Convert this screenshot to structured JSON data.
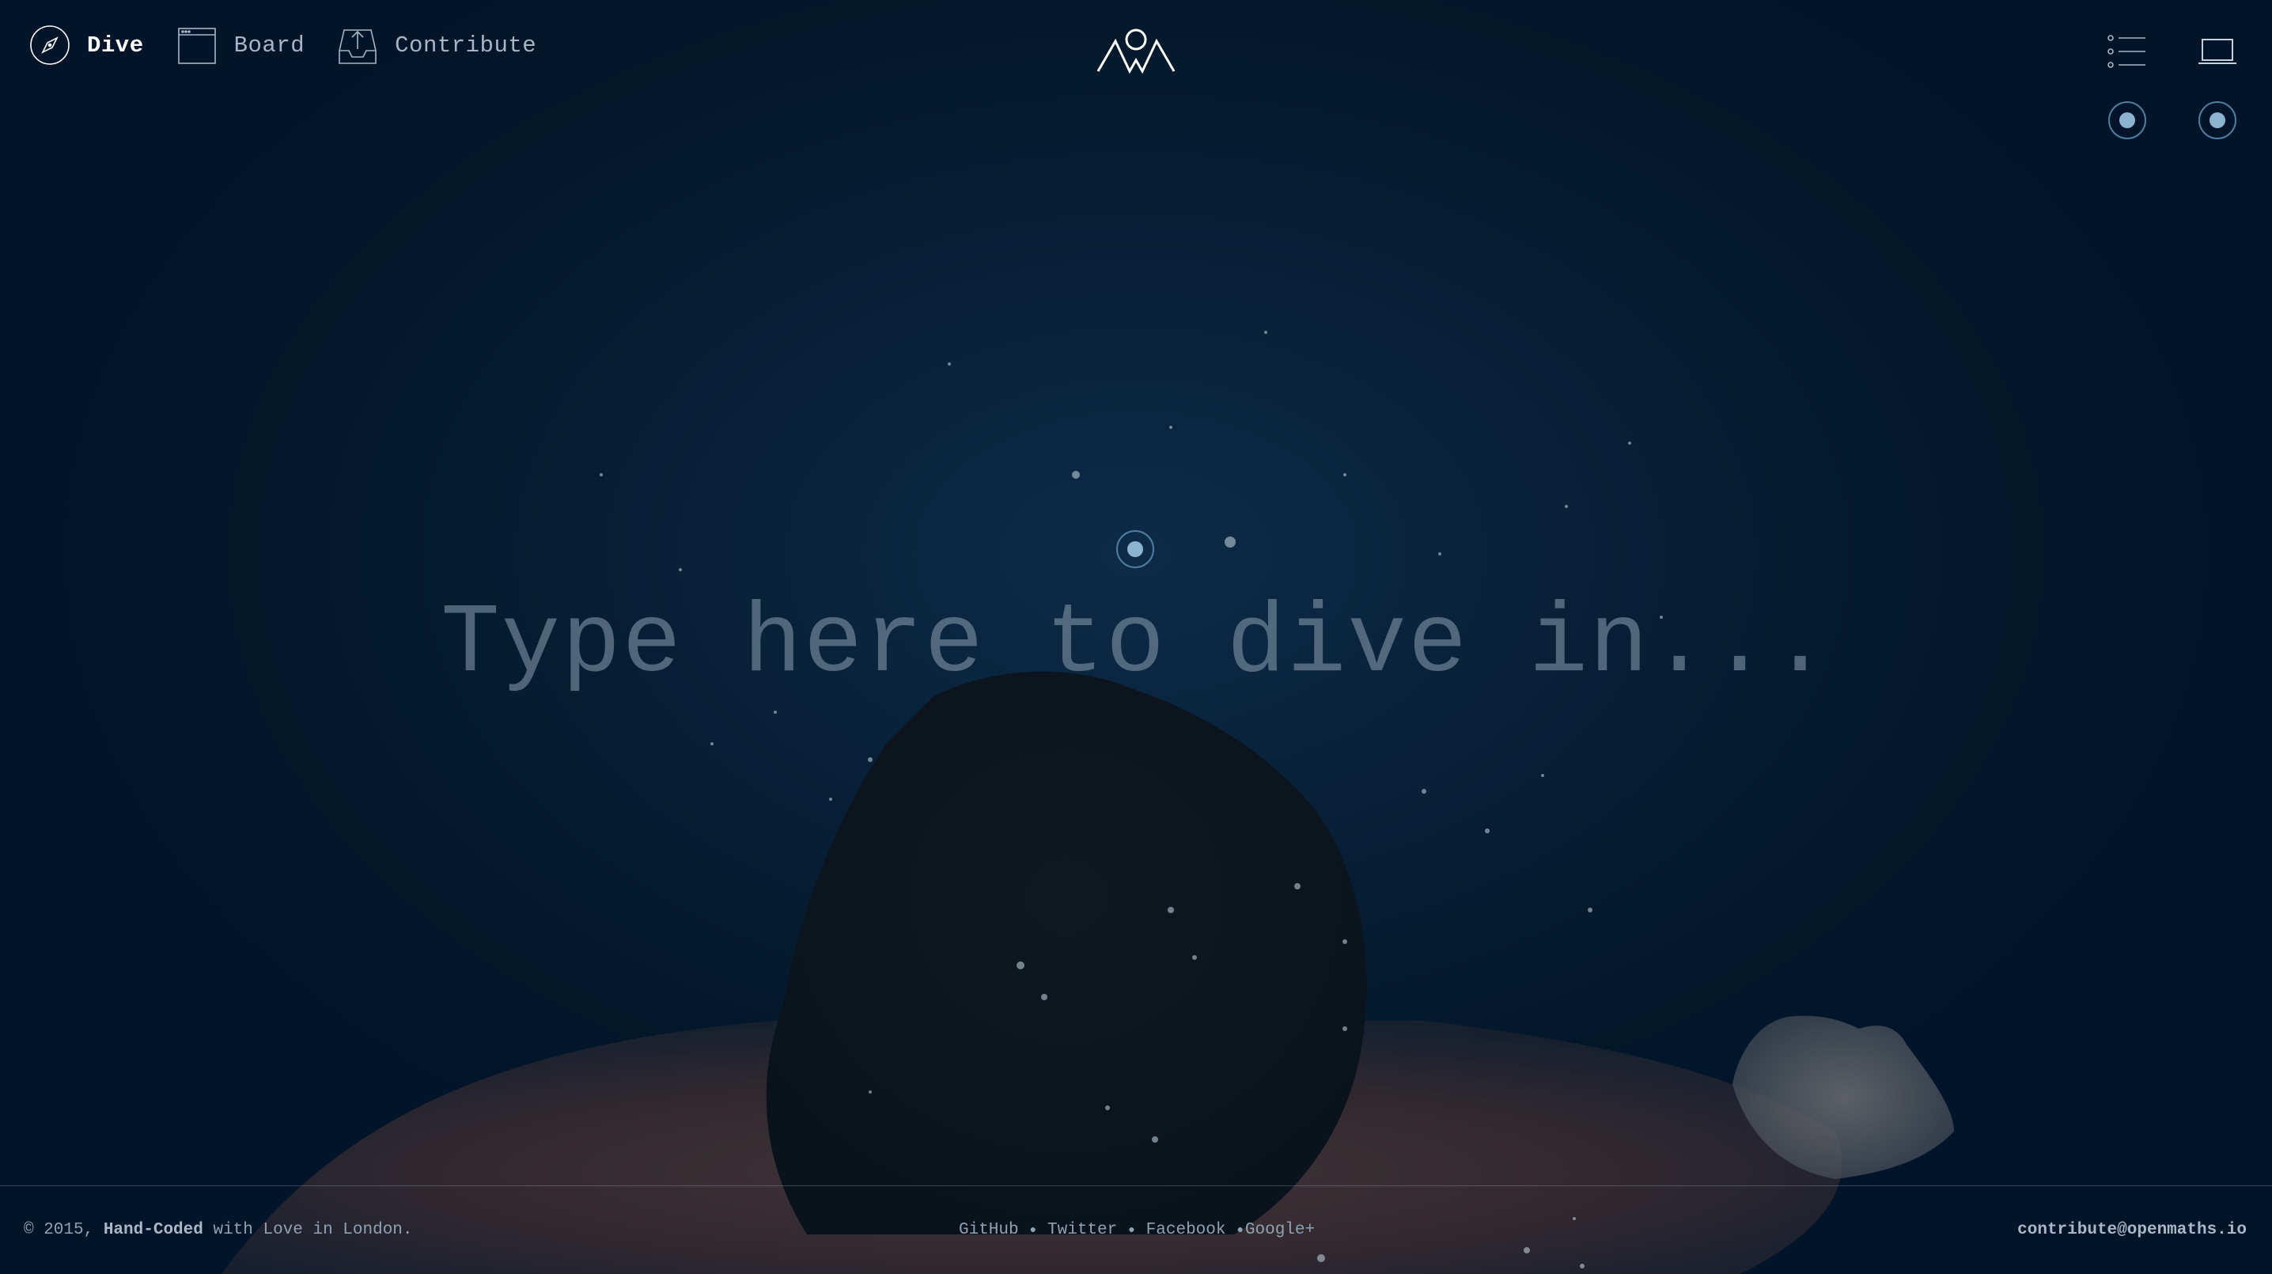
{
  "nav": {
    "items": [
      {
        "label": "Dive",
        "icon": "compass-icon",
        "active": true
      },
      {
        "label": "Board",
        "icon": "browser-window-icon",
        "active": false
      },
      {
        "label": "Contribute",
        "icon": "tray-upload-icon",
        "active": false
      }
    ]
  },
  "logo": {
    "name": "mountain-circle-logo"
  },
  "top_right": {
    "icons": [
      "list-icon",
      "laptop-icon"
    ]
  },
  "search": {
    "placeholder": "Type here to dive in...",
    "value": ""
  },
  "footer": {
    "copyright_prefix": "© 2015, ",
    "copyright_bold": "Hand-Coded",
    "copyright_suffix": " with Love in London.",
    "links": [
      "GitHub",
      "Twitter",
      "Facebook",
      "Google+"
    ],
    "email": "contribute@openmaths.io"
  },
  "colors": {
    "background": "#03182c",
    "accent_dot": "#8cb3cf",
    "text_muted": "#8fa2b3"
  }
}
